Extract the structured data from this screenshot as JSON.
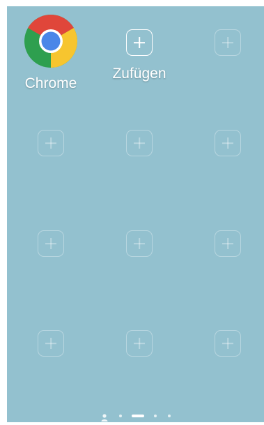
{
  "apps": [
    {
      "name": "chrome",
      "label": "Chrome"
    },
    {
      "name": "add",
      "label": "Zufügen"
    }
  ],
  "colors": {
    "wallpaper": "#93c1cf",
    "icon_outline": "#ffffff",
    "placeholder_outline": "rgba(255,255,255,0.35)"
  },
  "pager": {
    "current_page": 2,
    "page_count": 4,
    "has_user_page": true
  }
}
